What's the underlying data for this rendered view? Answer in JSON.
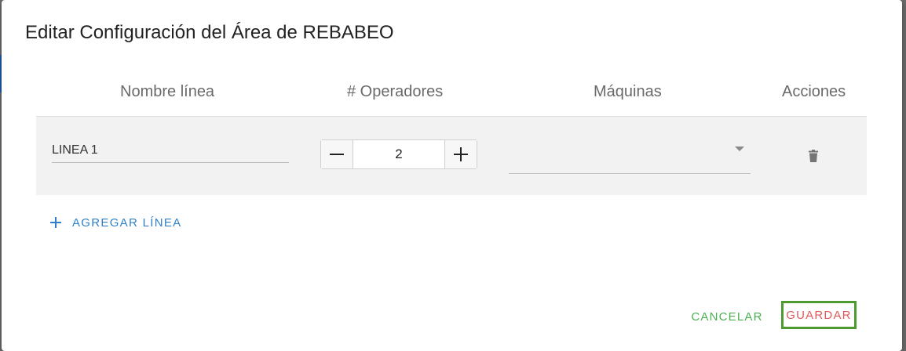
{
  "dialog": {
    "title": "Editar Configuración del Área de REBABEO"
  },
  "table": {
    "headers": {
      "name": "Nombre línea",
      "operators": "# Operadores",
      "machines": "Máquinas",
      "actions": "Acciones"
    },
    "rows": [
      {
        "name": "LINEA 1",
        "operators": "2",
        "machines": ""
      }
    ]
  },
  "actions": {
    "add_line_label": "AGREGAR LÍNEA",
    "cancel_label": "CANCELAR",
    "save_label": "GUARDAR"
  },
  "icons": {
    "add": "plus-icon",
    "delete": "trash-icon",
    "dropdown": "chevron-down-icon",
    "decrement": "minus-icon",
    "increment": "plus-icon"
  },
  "colors": {
    "accent_blue": "#2f80c8",
    "cancel_green": "#4caf50",
    "save_red": "#e05a5a",
    "highlight_border": "#4d9a2e"
  }
}
